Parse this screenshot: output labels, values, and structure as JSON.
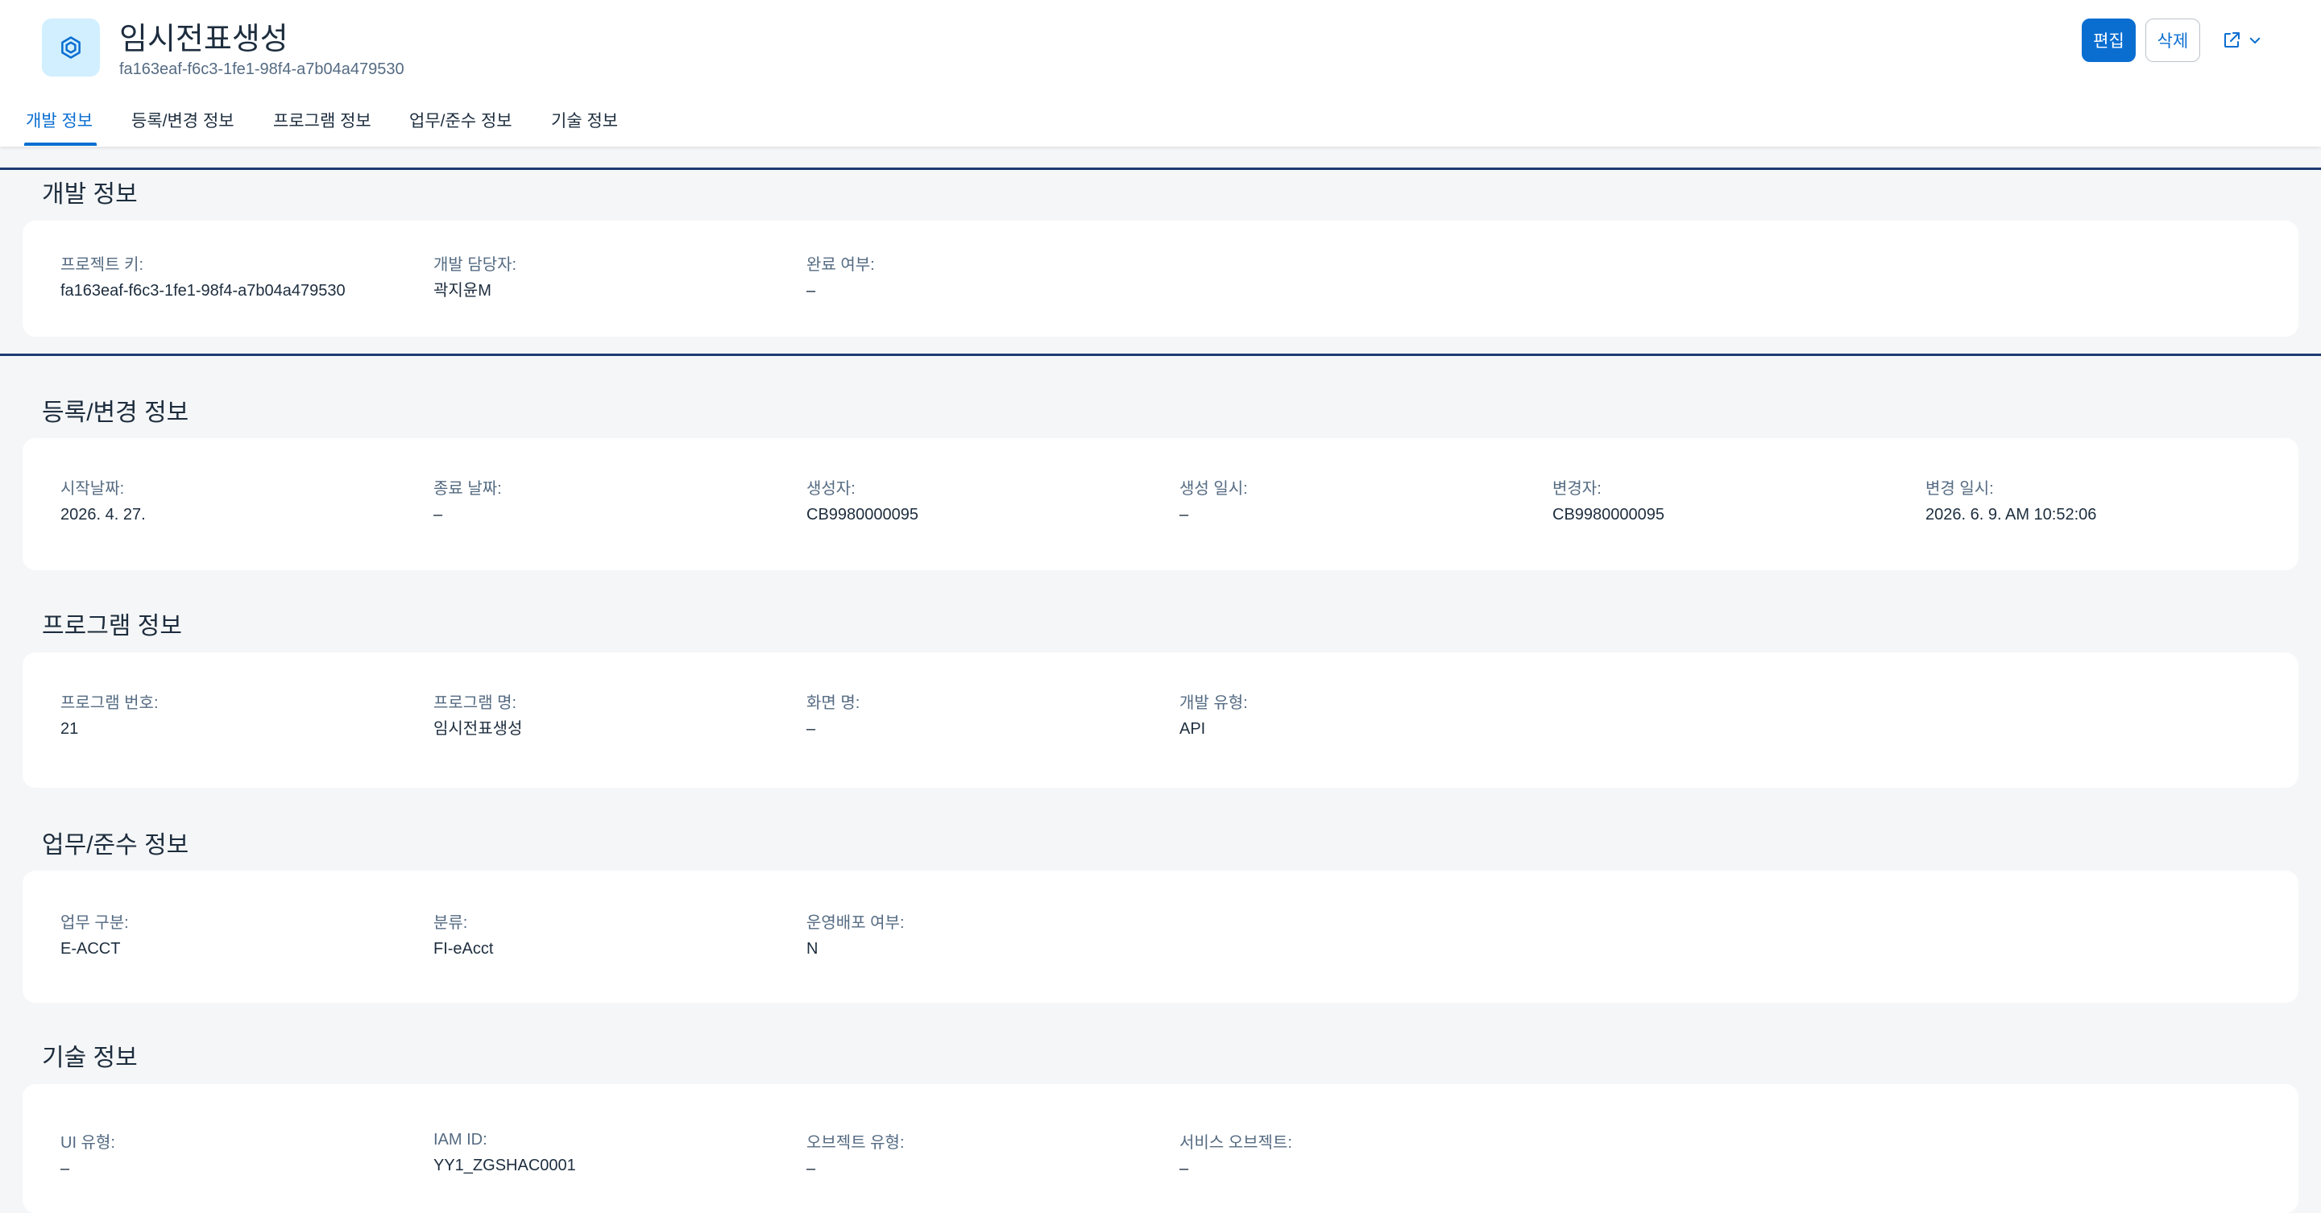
{
  "header": {
    "title": "임시전표생성",
    "subtitle": "fa163eaf-f6c3-1fe1-98f4-a7b04a479530",
    "edit_label": "편집",
    "delete_label": "삭제",
    "share_icon": "share-icon",
    "chevron_icon": "chevron-down-icon",
    "accent_color": "#0a6ed1"
  },
  "tabs": [
    {
      "label": "개발 정보",
      "active": true
    },
    {
      "label": "등록/변경 정보"
    },
    {
      "label": "프로그램 정보"
    },
    {
      "label": "업무/준수 정보"
    },
    {
      "label": "기술 정보"
    }
  ],
  "sections": {
    "dev": {
      "title": "개발 정보",
      "fields": [
        {
          "label": "프로젝트 키:",
          "value": "fa163eaf-f6c3-1fe1-98f4-a7b04a479530"
        },
        {
          "label": "개발 담당자:",
          "value": "곽지윤M"
        },
        {
          "label": "완료 여부:",
          "value": "–"
        }
      ]
    },
    "reg": {
      "title": "등록/변경 정보",
      "fields": [
        {
          "label": "시작날짜:",
          "value": "2026. 4. 27."
        },
        {
          "label": "종료 날짜:",
          "value": "–"
        },
        {
          "label": "생성자:",
          "value": "CB9980000095"
        },
        {
          "label": "생성 일시:",
          "value": "–"
        },
        {
          "label": "변경자:",
          "value": "CB9980000095"
        },
        {
          "label": "변경 일시:",
          "value": "2026. 6. 9. AM 10:52:06"
        }
      ]
    },
    "program": {
      "title": "프로그램 정보",
      "fields": [
        {
          "label": "프로그램 번호:",
          "value": "21"
        },
        {
          "label": "프로그램 명:",
          "value": "임시전표생성"
        },
        {
          "label": "화면 명:",
          "value": "–"
        },
        {
          "label": "개발 유형:",
          "value": "API"
        }
      ]
    },
    "biz": {
      "title": "업무/준수 정보",
      "fields": [
        {
          "label": "업무 구분:",
          "value": "E-ACCT"
        },
        {
          "label": "분류:",
          "value": "FI-eAcct"
        },
        {
          "label": "운영배포 여부:",
          "value": "N"
        }
      ]
    },
    "tech": {
      "title": "기술 정보",
      "fields": [
        {
          "label": "UI 유형:",
          "value": "–"
        },
        {
          "label": "IAM ID:",
          "value": "YY1_ZGSHAC0001"
        },
        {
          "label": "오브젝트 유형:",
          "value": "–"
        },
        {
          "label": "서비스 오브젝트:",
          "value": "–"
        }
      ]
    }
  }
}
